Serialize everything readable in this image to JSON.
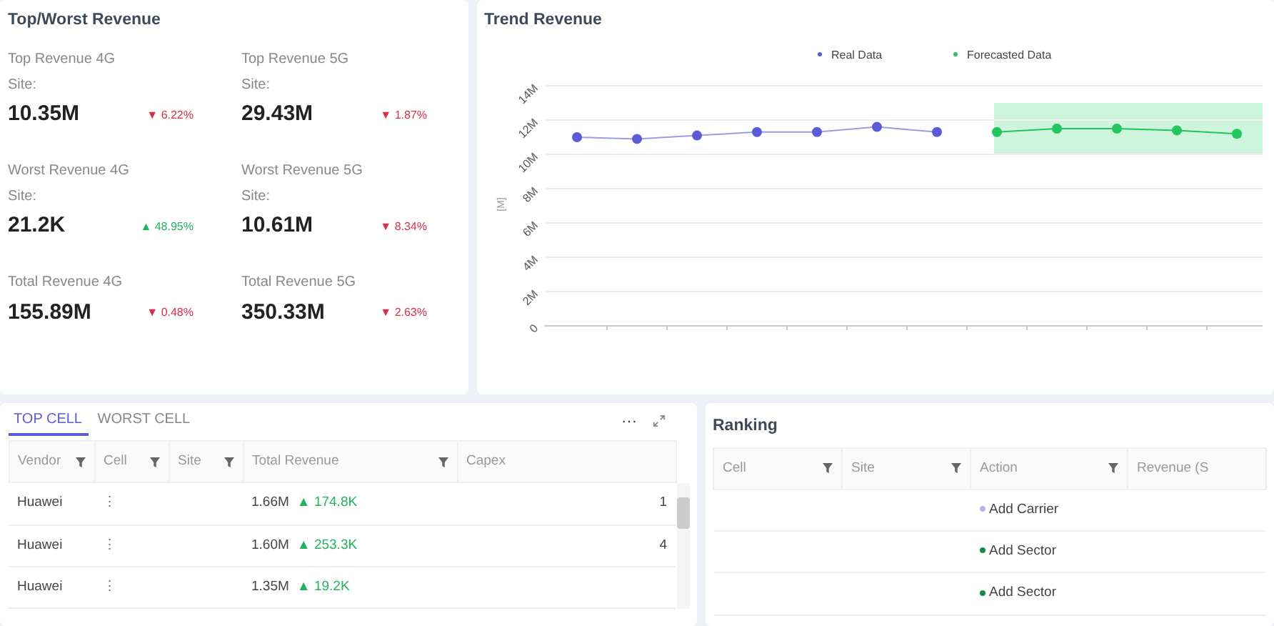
{
  "summary": {
    "title": "Top/Worst Revenue",
    "kpis": [
      {
        "label": "Top Revenue 4G",
        "sub": "Site:",
        "value": "10.35M",
        "delta": "▼ 6.22%",
        "color": "#d9304a"
      },
      {
        "label": "Top Revenue 5G",
        "sub": "Site:",
        "value": "29.43M",
        "delta": "▼ 1.87%",
        "color": "#d9304a"
      },
      {
        "label": "Worst Revenue 4G",
        "sub": "Site:",
        "value": "21.2K",
        "delta": "▲ 48.95%",
        "color": "#22b35e"
      },
      {
        "label": "Worst Revenue 5G",
        "sub": "Site:",
        "value": "10.61M",
        "delta": "▼ 8.34%",
        "color": "#d9304a"
      },
      {
        "label": "Total Revenue 4G",
        "value": "155.89M",
        "delta": "▼ 0.48%",
        "color": "#d9304a"
      },
      {
        "label": "Total Revenue 5G",
        "value": "350.33M",
        "delta": "▼ 2.63%",
        "color": "#d9304a"
      }
    ]
  },
  "trend": {
    "title": "Trend Revenue",
    "chart_data": {
      "type": "line",
      "ylabel": "[M]",
      "grid": true,
      "legend": true,
      "ylim": [
        0,
        14
      ],
      "yticks": [
        {
          "value": 0,
          "label": "0"
        },
        {
          "value": 2,
          "label": "2M"
        },
        {
          "value": 4,
          "label": "4M"
        },
        {
          "value": 6,
          "label": "6M"
        },
        {
          "value": 8,
          "label": "8M"
        },
        {
          "value": 10,
          "label": "10M"
        },
        {
          "value": 12,
          "label": "12M"
        },
        {
          "value": 14,
          "label": "14M"
        }
      ],
      "series": [
        {
          "name": "Real Data",
          "color": "#5b5bd6",
          "marker": "circle",
          "values": [
            11.0,
            10.9,
            11.1,
            11.3,
            11.3,
            11.6,
            11.3,
            null,
            null,
            null,
            null,
            null
          ]
        },
        {
          "name": "Forecasted Data",
          "color": "#22c55e",
          "marker": "circle",
          "values": [
            null,
            null,
            null,
            null,
            null,
            null,
            null,
            11.3,
            11.5,
            11.5,
            11.4,
            11.2
          ]
        }
      ],
      "bands": [
        {
          "axis": "y",
          "from": 10,
          "to": 13,
          "color": "#ccf5dc"
        }
      ]
    }
  },
  "cells": {
    "tabs": [
      {
        "label": "TOP CELL",
        "selected": true
      },
      {
        "label": "WORST CELL",
        "selected": false
      }
    ],
    "more": "···",
    "columns": [
      "Vendor",
      "Cell",
      "Site",
      "Total Revenue",
      "Capex"
    ],
    "rows": [
      {
        "vendor": "Huawei",
        "cell": "⋮",
        "revenue": "1.66M",
        "delta": "▲ 174.8K",
        "color": "#22b35e",
        "capex": "1"
      },
      {
        "vendor": "Huawei",
        "cell": "⋮",
        "revenue": "1.60M",
        "delta": "▲ 253.3K",
        "color": "#22b35e",
        "capex": "4"
      },
      {
        "vendor": "Huawei",
        "cell": "⋮",
        "revenue": "1.35M",
        "delta": "▲ 19.2K",
        "color": "#22b35e"
      }
    ]
  },
  "ranking": {
    "title": "Ranking",
    "columns": [
      "Cell",
      "Site",
      "Action",
      "Revenue (S"
    ],
    "rows": [
      {
        "action": "Add Carrier",
        "color": "#b4b4e8"
      },
      {
        "action": "Add Sector",
        "color": "#1a8a4a"
      },
      {
        "action": "Add Sector",
        "color": "#1a8a4a"
      }
    ]
  }
}
